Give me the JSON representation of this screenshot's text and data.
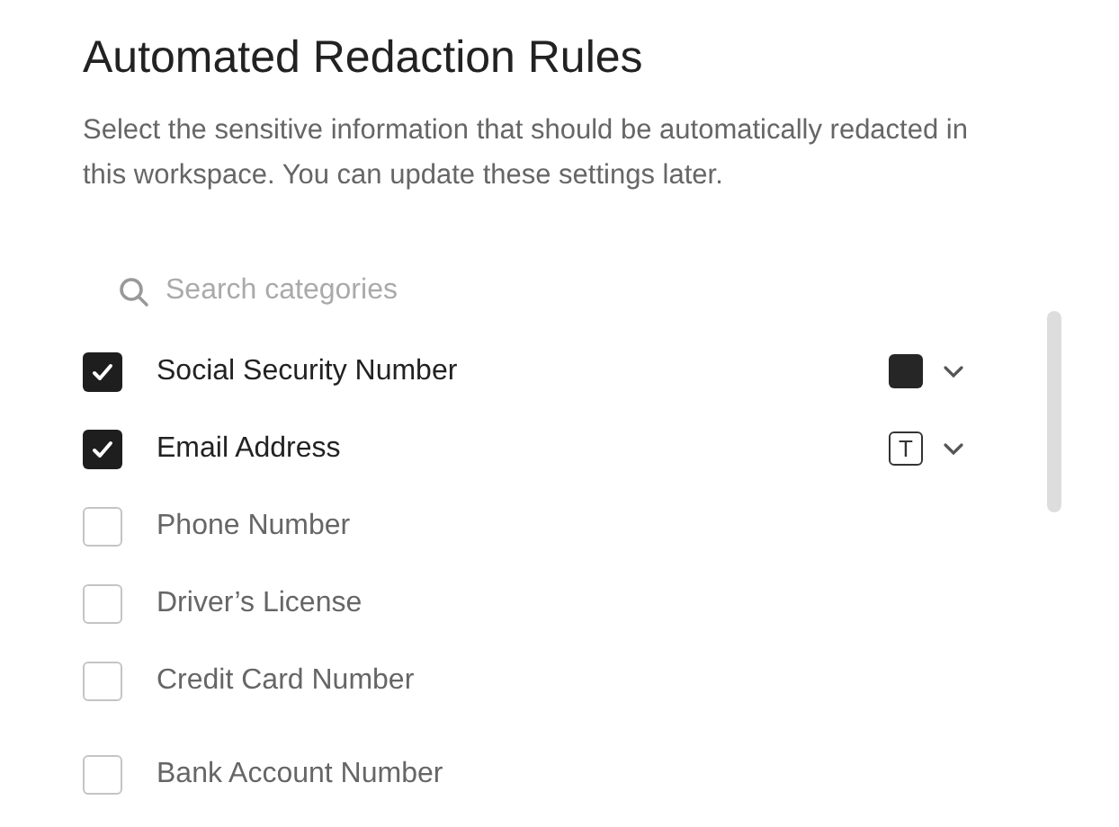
{
  "title": "Automated Redaction Rules",
  "description": "Select the sensitive information that should be automatically redacted in this workspace. You can update these settings later.",
  "search": {
    "placeholder": "Search categories"
  },
  "categories": [
    {
      "label": "Social Security Number",
      "checked": true,
      "style": {
        "kind": "block"
      }
    },
    {
      "label": "Email Address",
      "checked": true,
      "style": {
        "kind": "text",
        "glyph": "T"
      }
    },
    {
      "label": "Phone Number",
      "checked": false
    },
    {
      "label": "Driver’s License",
      "checked": false
    },
    {
      "label": "Credit Card Number",
      "checked": false
    },
    {
      "label": "Bank Account Number",
      "checked": false
    }
  ]
}
